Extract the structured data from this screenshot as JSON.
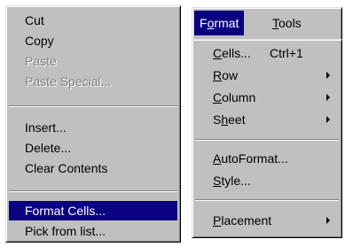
{
  "context_menu": {
    "items": [
      {
        "label": "Cut",
        "state": "enabled"
      },
      {
        "label": "Copy",
        "state": "enabled"
      },
      {
        "label": "Paste",
        "state": "disabled"
      },
      {
        "label": "Paste Special...",
        "state": "disabled"
      },
      {
        "label": "Insert...",
        "state": "enabled"
      },
      {
        "label": "Delete...",
        "state": "enabled"
      },
      {
        "label": "Clear Contents",
        "state": "enabled"
      },
      {
        "label": "Format Cells...",
        "state": "selected"
      },
      {
        "label": "Pick from list...",
        "state": "enabled"
      }
    ]
  },
  "menubar": {
    "format": {
      "pre": "F",
      "ul": "o",
      "post": "rmat"
    },
    "tools": {
      "pre": "",
      "ul": "T",
      "post": "ools"
    }
  },
  "format_menu": {
    "items": [
      {
        "pre": "",
        "ul": "C",
        "post": "ells...",
        "shortcut": "Ctrl+1",
        "submenu": false
      },
      {
        "pre": "",
        "ul": "R",
        "post": "ow",
        "shortcut": "",
        "submenu": true
      },
      {
        "pre": "",
        "ul": "C",
        "post": "olumn",
        "shortcut": "",
        "submenu": true
      },
      {
        "pre": "S",
        "ul": "h",
        "post": "eet",
        "shortcut": "",
        "submenu": true
      },
      {
        "pre": "",
        "ul": "A",
        "post": "utoFormat...",
        "shortcut": "",
        "submenu": false
      },
      {
        "pre": "",
        "ul": "S",
        "post": "tyle...",
        "shortcut": "",
        "submenu": false
      },
      {
        "pre": "",
        "ul": "P",
        "post": "lacement",
        "shortcut": "",
        "submenu": true
      }
    ]
  },
  "colors": {
    "menu_face": "#c0c0c0",
    "highlight": "#0a0080",
    "highlight_text": "#ffffff",
    "disabled_text": "#808080"
  },
  "icons": {
    "submenu": "submenu-arrow-icon"
  }
}
